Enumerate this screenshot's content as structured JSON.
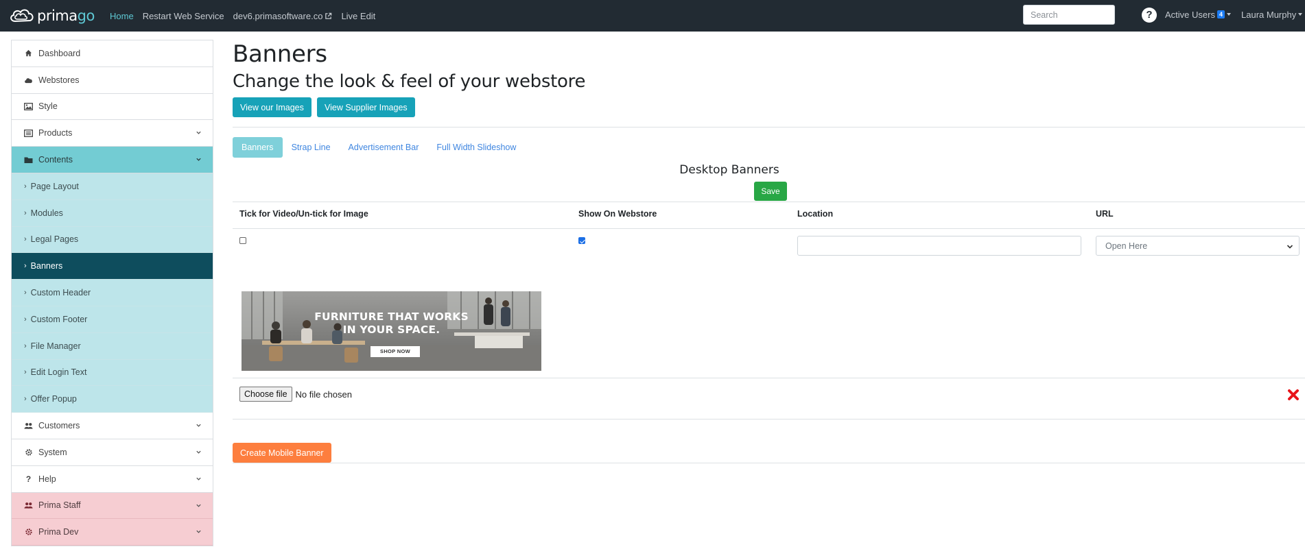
{
  "brand": {
    "name_a": "prima",
    "name_b": "go"
  },
  "nav": {
    "links": [
      {
        "label": "Home",
        "active": true
      },
      {
        "label": "Restart Web Service"
      },
      {
        "label": "dev6.primasoftware.co"
      },
      {
        "label": "Live Edit"
      }
    ],
    "search_placeholder": "Search",
    "help_glyph": "?",
    "active_users_label": "Active Users",
    "active_users_count": "4",
    "user_name": "Laura Murphy"
  },
  "sidebar": {
    "items": [
      {
        "label": "Dashboard",
        "icon": "home-icon"
      },
      {
        "label": "Webstores",
        "icon": "cloud-icon"
      },
      {
        "label": "Style",
        "icon": "image-icon"
      },
      {
        "label": "Products",
        "icon": "list-icon",
        "has_chevron": true
      },
      {
        "label": "Contents",
        "icon": "folder-icon",
        "has_chevron": true,
        "open": true
      }
    ],
    "contents_sub": [
      "Page Layout",
      "Modules",
      "Legal Pages",
      "Banners",
      "Custom Header",
      "Custom Footer",
      "File Manager",
      "Edit Login Text",
      "Offer Popup"
    ],
    "active_sub": "Banners",
    "items_after": [
      {
        "label": "Customers",
        "icon": "users-icon"
      },
      {
        "label": "System",
        "icon": "gear-icon"
      },
      {
        "label": "Help",
        "icon": "question-icon"
      },
      {
        "label": "Prima Staff",
        "icon": "users-icon"
      },
      {
        "label": "Prima Dev",
        "icon": "gear-icon"
      }
    ]
  },
  "main": {
    "title": "Banners",
    "subtitle": "Change the look & feel of your webstore",
    "view_images_label": "View our Images",
    "view_supplier_images_label": "View Supplier Images",
    "tabs": [
      "Banners",
      "Strap Line",
      "Advertisement Bar",
      "Full Width Slideshow"
    ],
    "active_tab": "Banners",
    "section_title": "Desktop Banners",
    "save_label": "Save",
    "table": {
      "headers": [
        "Tick for Video/Un-tick for Image",
        "Show On Webstore",
        "Location",
        "URL"
      ],
      "video_checked": false,
      "show_checked": true,
      "location_value": "",
      "url_value": "Open Here"
    },
    "banner": {
      "line1": "FURNITURE THAT WORKS",
      "line2": "IN YOUR SPACE.",
      "button": "SHOP NOW"
    },
    "file_button_label": "Choose file",
    "file_status": "No file chosen",
    "create_mobile_label": "Create Mobile Banner"
  },
  "colors": {
    "navbar": "#222b33",
    "accent_teal": "#17a2b8",
    "sidebar_open": "#73ccd3",
    "sidebar_sub": "#bde5ea",
    "sidebar_active": "#0e4d5d",
    "staff_pink": "#f6cdd2",
    "save_green": "#28a745",
    "create_orange": "#fd7e3e",
    "delete_red": "#e8151b"
  }
}
